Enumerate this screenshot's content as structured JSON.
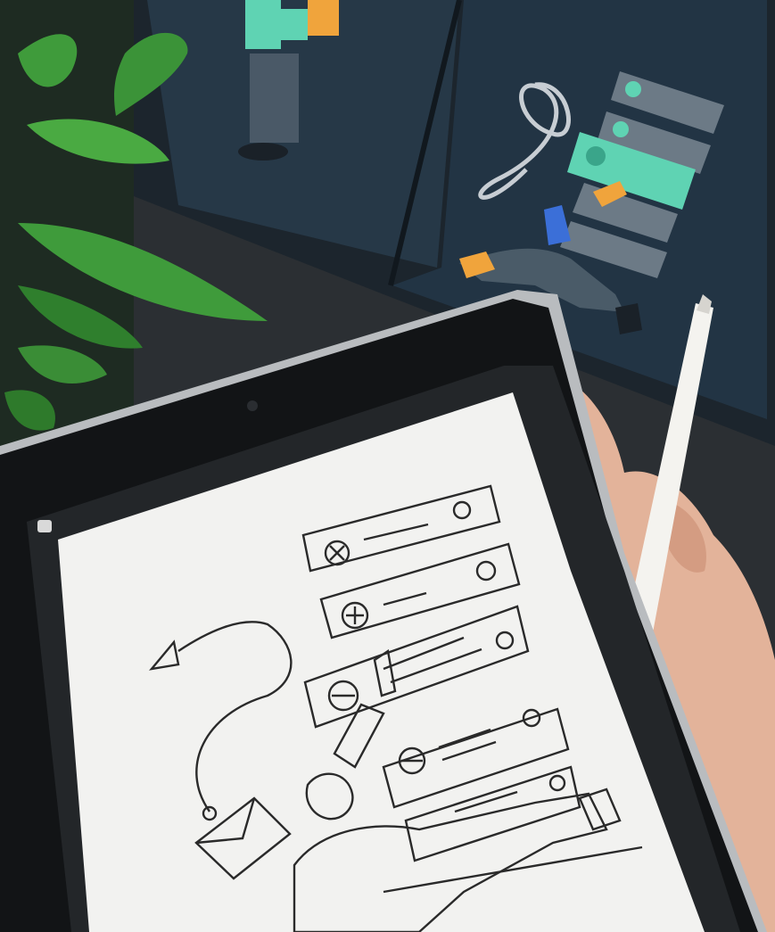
{
  "photo": {
    "subject": "",
    "palette": {
      "monitor_bg": "#1f2a33",
      "monitor_panel": "#243744",
      "accent_teal": "#5fd3b3",
      "card_gray": "#6c7a86",
      "figure_orange": "#f0a43c",
      "figure_blue": "#3b6fd8",
      "tablet_bezel": "#121416",
      "tablet_screen": "#f2f2f0",
      "sketch_ink": "#2a2a2a",
      "pencil_white": "#f4f3ef",
      "skin": "#e3b39a",
      "leaf_green": "#3f9b3b",
      "keyboard": "#e9e9ea"
    }
  }
}
